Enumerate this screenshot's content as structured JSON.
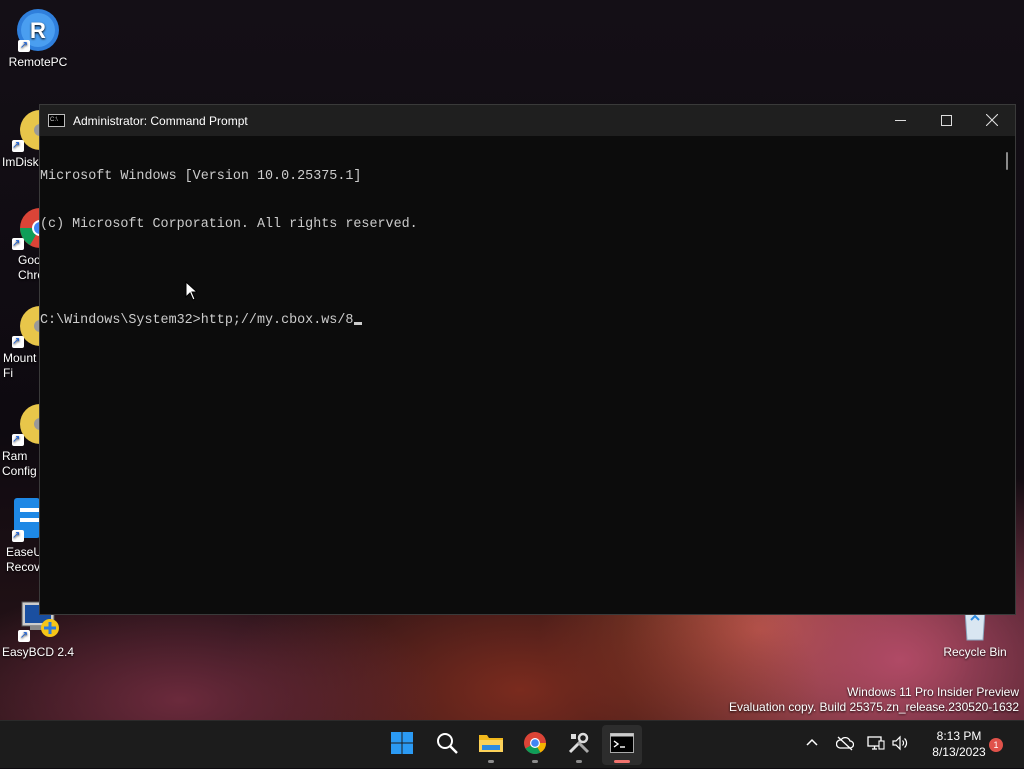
{
  "desktop": {
    "icons": [
      {
        "label": "RemotePC"
      },
      {
        "label": "ImDisk Disk I"
      },
      {
        "label": "Goo Chro"
      },
      {
        "label": "Mount Fi"
      },
      {
        "label": "Ram Config"
      },
      {
        "label": "EaseU Recov"
      },
      {
        "label": "EasyBCD 2.4"
      },
      {
        "label": "Recycle Bin"
      }
    ],
    "watermark": {
      "line1": "Windows 11 Pro Insider Preview",
      "line2": "Evaluation copy. Build 25375.zn_release.230520-1632"
    }
  },
  "window": {
    "title": "Administrator: Command Prompt",
    "icon": "cmd-icon",
    "buttons": {
      "minimize": "─",
      "maximize": "☐",
      "close": "✕"
    },
    "console_lines": [
      "Microsoft Windows [Version 10.0.25375.1]",
      "(c) Microsoft Corporation. All rights reserved.",
      "",
      "C:\\Windows\\System32>http;//my.cbox.ws/8"
    ]
  },
  "taskbar": {
    "apps": [
      {
        "name": "start-button",
        "icon": "windows-logo-icon"
      },
      {
        "name": "search-button",
        "icon": "search-icon"
      },
      {
        "name": "file-explorer",
        "icon": "folder-icon"
      },
      {
        "name": "chrome",
        "icon": "chrome-icon"
      },
      {
        "name": "tools",
        "icon": "tools-icon"
      },
      {
        "name": "command-prompt",
        "icon": "terminal-icon"
      }
    ],
    "clock": {
      "time": "8:13 PM",
      "date": "8/13/2023"
    },
    "notification_count": "1"
  },
  "colors": {
    "console_bg": "#0c0c0c",
    "console_text": "#cccccc",
    "taskbar_bg": "#1c1c1c",
    "accent": "#f0736e"
  }
}
